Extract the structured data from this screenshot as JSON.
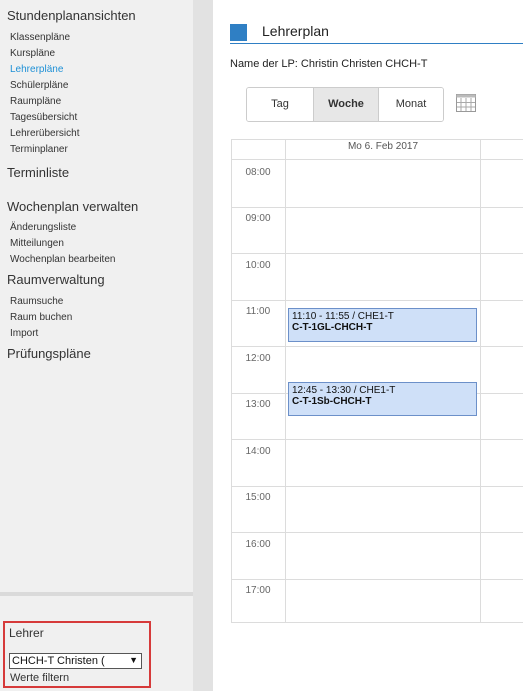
{
  "sidebar": {
    "sections": [
      {
        "label": "Stundenplanansichten"
      },
      {
        "label": "Terminliste"
      },
      {
        "label": "Wochenplan verwalten"
      },
      {
        "label": "Raumverwaltung"
      },
      {
        "label": "Prüfungspläne"
      }
    ],
    "stundenplan_items": [
      "Klassenpläne",
      "Kurspläne",
      "Lehrerpläne",
      "Schülerpläne",
      "Raumpläne",
      "Tagesübersicht",
      "Lehrerübersicht",
      "Terminplaner"
    ],
    "wochenplan_items": [
      "Änderungsliste",
      "Mitteilungen",
      "Wochenplan bearbeiten"
    ],
    "raum_items": [
      "Raumsuche",
      "Raum buchen",
      "Import"
    ],
    "filter": {
      "label": "Lehrer",
      "selected": "CHCH-T Christen (",
      "werte_filtern": "Werte filtern"
    }
  },
  "main": {
    "title": "Lehrerplan",
    "lp_name": "Name der LP: Christin Christen CHCH-T",
    "view_buttons": [
      "Tag",
      "Woche",
      "Monat"
    ],
    "active_view": "Woche",
    "calendar_icon": "calendar-icon",
    "day_header": "Mo 6. Feb 2017",
    "times": [
      "08:00",
      "09:00",
      "10:00",
      "11:00",
      "12:00",
      "13:00",
      "14:00",
      "15:00",
      "16:00",
      "17:00"
    ],
    "events": [
      {
        "line1": "11:10 - 11:55 / CHE1-T",
        "line2": "C-T-1GL-CHCH-T"
      },
      {
        "line1": "12:45 - 13:30 / CHE1-T",
        "line2": "C-T-1Sb-CHCH-T"
      }
    ]
  },
  "colors": {
    "accent": "#2f7fc4",
    "active_link": "#1e90d6",
    "event_bg": "#cfe0f8",
    "event_border": "#6c90c9",
    "highlight_box": "#d63a3a"
  }
}
